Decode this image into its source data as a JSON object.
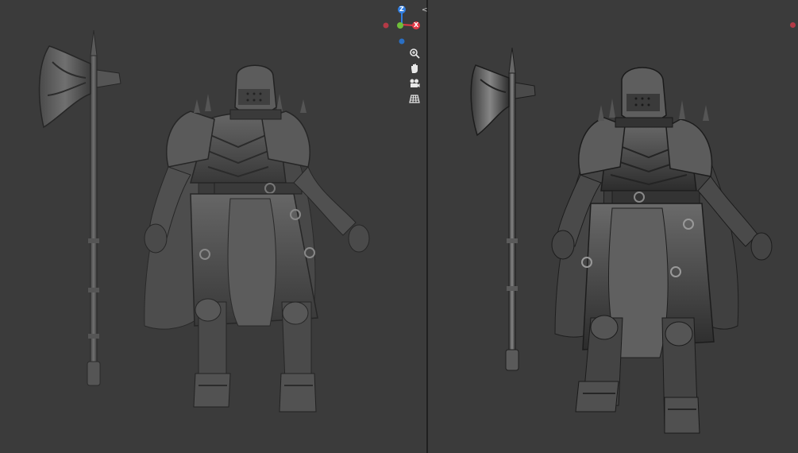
{
  "gizmo": {
    "axis_z_label": "Z",
    "axis_x_label": "X",
    "colors": {
      "z": "#2f7de1",
      "x": "#e23a47",
      "y": "#6fbf3a",
      "neg_x": "#b43a46",
      "neg_y": "#2a6fc4"
    }
  },
  "navigation_tools": [
    {
      "name": "zoom",
      "icon": "zoom-icon"
    },
    {
      "name": "pan",
      "icon": "hand-icon"
    },
    {
      "name": "orbit",
      "icon": "camera-icon"
    },
    {
      "name": "perspective",
      "icon": "grid-icon"
    }
  ],
  "split_handle_icon": "<>",
  "viewports": [
    {
      "name": "left",
      "shading": "flat-clay"
    },
    {
      "name": "right",
      "shading": "dark-clay"
    }
  ],
  "colors": {
    "background": "#3b3b3b",
    "divider": "#1f1f1f",
    "clay_light": "#6a6a6a",
    "clay_dark": "#2e2e2e"
  }
}
